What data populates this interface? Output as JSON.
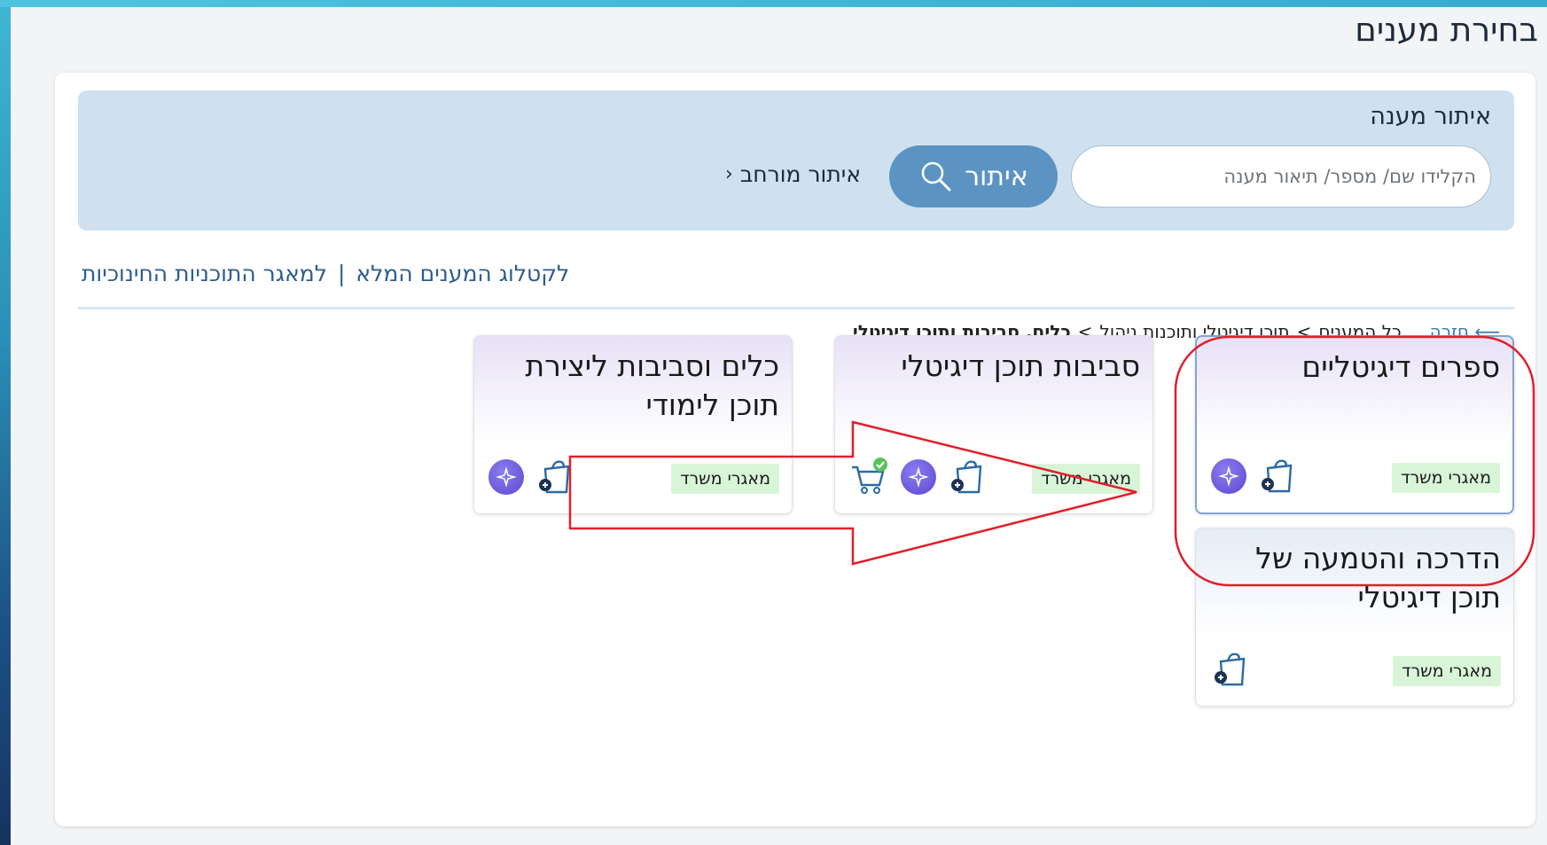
{
  "page": {
    "title": "בחירת מענים"
  },
  "search": {
    "title": "איתור מענה",
    "placeholder": "הקלידו שם/ מספר/ תיאור מענה",
    "button_label": "איתור",
    "advanced_label": "איתור מורחב"
  },
  "links": {
    "catalog": "לקטלוג המענים המלא",
    "separator": "|",
    "programs": "למאגר התוכניות החינוכיות"
  },
  "breadcrumb": {
    "back": "⟵ חזרה",
    "all": "כל המענים",
    "sep1": ">",
    "level2": "תוכן דיגיטלי ותוכנות ניהול",
    "sep2": ">",
    "current": "כלים, סביבות ותוכן דיגיטלי"
  },
  "tiles": [
    {
      "title": "ספרים דיגיטליים",
      "badge": "מאגרי משרד",
      "icons": [
        "ai-sparkle-icon",
        "add-to-bag-icon"
      ],
      "selected": true
    },
    {
      "title": "סביבות תוכן דיגיטלי",
      "badge": "מאגרי משרד",
      "icons": [
        "cart-check-icon",
        "ai-sparkle-icon",
        "add-to-bag-icon"
      ],
      "selected": false
    },
    {
      "title": "כלים וסביבות ליצירת תוכן לימודי",
      "badge": "מאגרי משרד",
      "icons": [
        "ai-sparkle-icon",
        "add-to-bag-icon"
      ],
      "selected": false
    },
    {
      "title": "הדרכה והטמעה של תוכן דיגיטלי",
      "badge": "מאגרי משרד",
      "icons": [
        "add-to-bag-icon"
      ],
      "selected": false
    }
  ],
  "colors": {
    "accent": "#5b94c3",
    "search_panel": "#cfe1ef",
    "badge_bg": "#d8f5d8",
    "annotation_red": "#e0202a",
    "check_green": "#58c25a"
  }
}
